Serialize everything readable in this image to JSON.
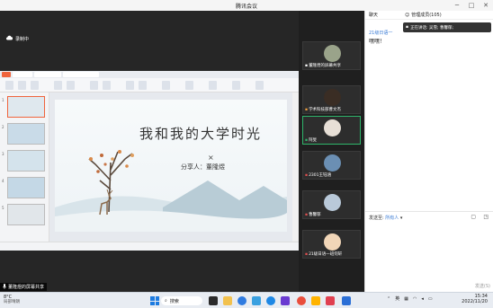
{
  "window": {
    "title": "腾讯会议"
  },
  "main": {
    "recording_label": "录制中",
    "sharer_label": "董隆煜的屏幕共享"
  },
  "ppt": {
    "slide_numbers": [
      "1",
      "2",
      "3",
      "4",
      "5"
    ],
    "slide": {
      "title": "我和我的大学时光",
      "presenter": "分享人：董隆煜",
      "symbol": "×"
    }
  },
  "participants": [
    {
      "name": "董隆煜的屏幕共享",
      "avatar_color": "#9aa38a",
      "muted": false
    },
    {
      "name": "学术科技部曹文杰",
      "avatar_color": "#3a2d24",
      "muted": true
    },
    {
      "name": "阿旻",
      "avatar_color": "#e7dfd6",
      "muted": false
    },
    {
      "name": "2301王钰涵",
      "avatar_color": "#6b8fb3",
      "muted": true
    },
    {
      "name": "曹馨郁",
      "avatar_color": "#b9c9d9",
      "muted": true
    },
    {
      "name": "21级日语一班何轩",
      "avatar_color": "#f1d6b8",
      "muted": true
    }
  ],
  "chat": {
    "tab_label": "聊天",
    "manage_label": "管理成员(105)",
    "toast": "正在讲话: 吴雪; 曹馨郁;",
    "sender": "21级日语一",
    "message": "嘿嘿！",
    "send_to_label": "发送至:",
    "send_to_target": "所有人",
    "send_button": "发送(S)"
  },
  "taskbar": {
    "weather_temp": "8°C",
    "weather_desc": "局部晴朗",
    "search_label": "搜索",
    "ime": "英",
    "time": "15:34",
    "date": "2022/11/20"
  },
  "colors": {
    "accent": "#3a7bd5",
    "speaking": "#2fb56b",
    "ppt_brand": "#f0643c"
  }
}
